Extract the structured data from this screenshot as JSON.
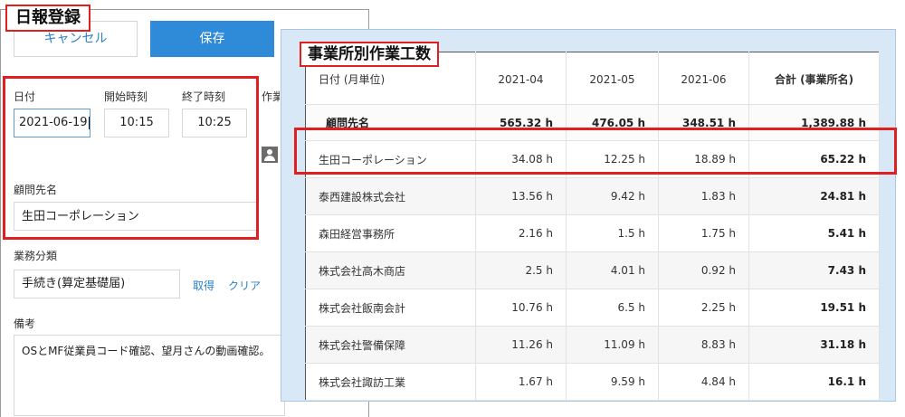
{
  "form": {
    "title": "日報登録",
    "cancel_label": "キャンセル",
    "save_label": "保存",
    "date_label": "日付",
    "start_label": "開始時刻",
    "end_label": "終了時刻",
    "work_label_partial": "作業",
    "date_value": "2021-06-19",
    "start_value": "10:15",
    "end_value": "10:25",
    "client_label": "顧問先名",
    "client_value": "生田コーポレーション",
    "category_label": "業務分類",
    "category_value": "手続き(算定基礎届)",
    "fetch_link": "取得",
    "clear_link": "クリア",
    "notes_label": "備考",
    "notes_value": "OSとMF従業員コード確認、望月さんの動画確認。"
  },
  "table": {
    "title": "事業所別作業工数",
    "headers": [
      "日付 (月単位)",
      "2021-04",
      "2021-05",
      "2021-06",
      "合計 (事業所名)"
    ],
    "summary": [
      "顧問先名",
      "565.32 h",
      "476.05 h",
      "348.51 h",
      "1,389.88 h"
    ],
    "rows": [
      [
        "生田コーポレーション",
        "34.08 h",
        "12.25 h",
        "18.89 h",
        "65.22 h"
      ],
      [
        "泰西建設株式会社",
        "13.56 h",
        "9.42 h",
        "1.83 h",
        "24.81 h"
      ],
      [
        "森田経営事務所",
        "2.16 h",
        "1.5 h",
        "1.75 h",
        "5.41 h"
      ],
      [
        "株式会社高木商店",
        "2.5 h",
        "4.01 h",
        "0.92 h",
        "7.43 h"
      ],
      [
        "株式会社飯南会計",
        "10.76 h",
        "6.5 h",
        "2.25 h",
        "19.51 h"
      ],
      [
        "株式会社警備保障",
        "11.26 h",
        "11.09 h",
        "8.83 h",
        "31.18 h"
      ],
      [
        "株式会社諏訪工業",
        "1.67 h",
        "9.59 h",
        "4.84 h",
        "16.1 h"
      ]
    ]
  },
  "colors": {
    "highlight": "#e02020",
    "accent_button": "#2f8bd8",
    "link": "#2a7fc8",
    "panel_background": "#d8e8f6"
  },
  "icons": {
    "assignee": "user-icon"
  }
}
